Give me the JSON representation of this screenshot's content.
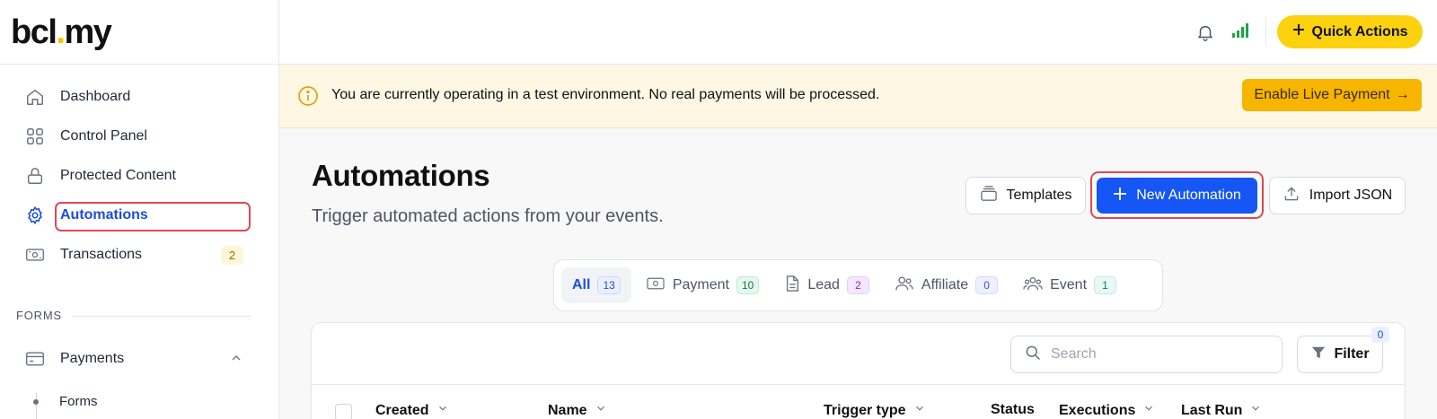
{
  "brand": {
    "logo_left": "bcl",
    "logo_dot": ".",
    "logo_right": "my"
  },
  "sidebar": {
    "items": [
      {
        "label": "Dashboard",
        "icon": "home-icon"
      },
      {
        "label": "Control Panel",
        "icon": "grid-icon"
      },
      {
        "label": "Protected Content",
        "icon": "lock-icon"
      },
      {
        "label": "Automations",
        "icon": "gear-icon",
        "active": true
      },
      {
        "label": "Transactions",
        "icon": "money-icon",
        "badge": "2"
      }
    ],
    "section_label": "FORMS",
    "payments": {
      "label": "Payments",
      "icon": "card-icon"
    },
    "sub_items": [
      {
        "label": "Forms"
      }
    ]
  },
  "topbar": {
    "quick_actions_label": "Quick Actions",
    "accent": "#fcd20e"
  },
  "banner": {
    "message": "You are currently operating in a test environment. No real payments will be processed.",
    "button_label": "Enable Live Payment",
    "button_arrow": "→"
  },
  "page": {
    "title": "Automations",
    "subtitle": "Trigger automated actions from your events.",
    "templates_label": "Templates",
    "new_label": "New Automation",
    "import_label": "Import JSON",
    "primary_color": "#1656f5"
  },
  "tabs": [
    {
      "label": "All",
      "count": "13"
    },
    {
      "label": "Payment",
      "count": "10"
    },
    {
      "label": "Lead",
      "count": "2"
    },
    {
      "label": "Affiliate",
      "count": "0"
    },
    {
      "label": "Event",
      "count": "1"
    }
  ],
  "table": {
    "search_placeholder": "Search",
    "filter_label": "Filter",
    "filter_count": "0",
    "columns": [
      "Created",
      "Name",
      "Trigger type",
      "Status",
      "Executions",
      "Last Run"
    ]
  }
}
